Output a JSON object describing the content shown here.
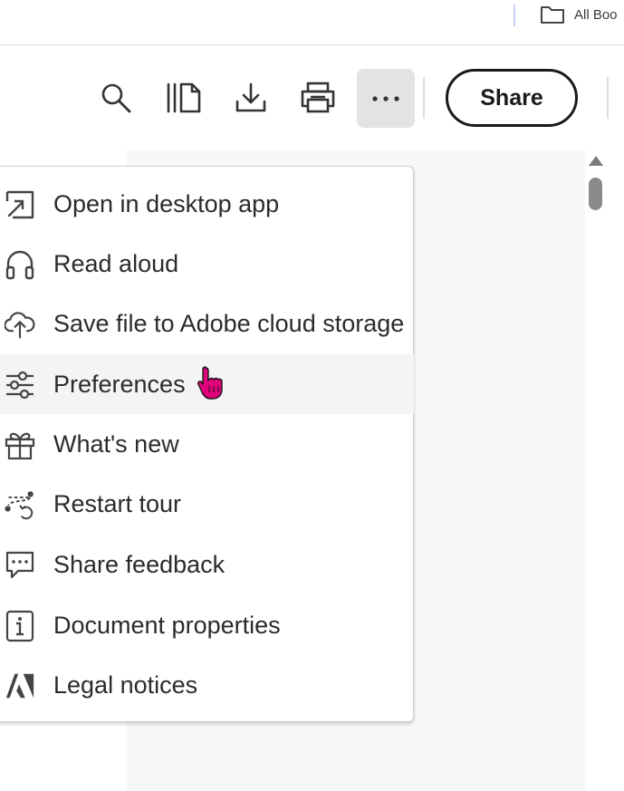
{
  "browser": {
    "bookmark_folder_label": "All Boo"
  },
  "toolbar": {
    "search_icon": "search-icon",
    "pages_icon": "organize-pages-icon",
    "download_icon": "download-icon",
    "print_icon": "print-icon",
    "more_icon": "more-options-icon",
    "share_label": "Share"
  },
  "menu": {
    "items": [
      {
        "label": "Open in desktop app",
        "icon": "open-external-icon"
      },
      {
        "label": "Read aloud",
        "icon": "headphones-icon"
      },
      {
        "label": "Save file to Adobe cloud storage",
        "icon": "cloud-upload-icon"
      },
      {
        "label": "Preferences",
        "icon": "sliders-icon",
        "hovered": true
      },
      {
        "label": "What's new",
        "icon": "gift-icon"
      },
      {
        "label": "Restart tour",
        "icon": "tour-icon"
      },
      {
        "label": "Share feedback",
        "icon": "feedback-icon"
      },
      {
        "label": "Document properties",
        "icon": "info-icon"
      },
      {
        "label": "Legal notices",
        "icon": "adobe-logo-icon"
      }
    ]
  },
  "colors": {
    "cursor": "#e0007a",
    "more_button_bg": "#e3e3e3"
  }
}
